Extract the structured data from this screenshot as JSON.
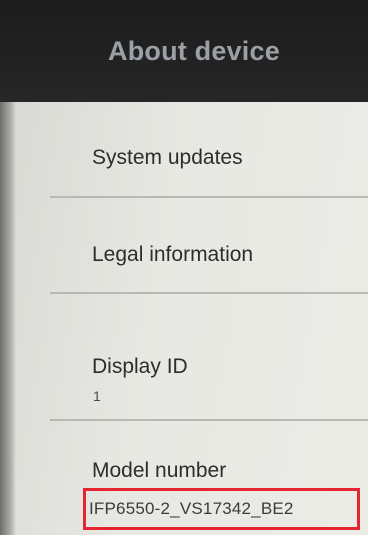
{
  "header": {
    "title": "About device"
  },
  "list": {
    "items": [
      {
        "label": "System updates"
      },
      {
        "label": "Legal information"
      },
      {
        "label": "Display ID",
        "value": "1"
      },
      {
        "label": "Model number",
        "value": "IFP6550-2_VS17342_BE2"
      }
    ]
  },
  "colors": {
    "header_bg": "#1c1c1c",
    "title_text": "#9aa0a6",
    "highlight_border": "#e32631"
  }
}
